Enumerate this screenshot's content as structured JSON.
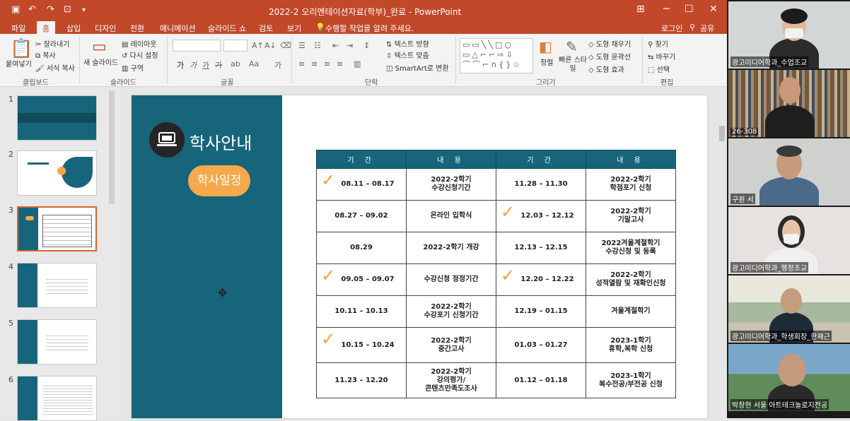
{
  "window": {
    "title": "2022-2 오리엔테이션자료(학부)_완료 - PowerPoint",
    "login": "로그인",
    "share": "공유",
    "tell_me": "수행할 작업을 알려 주세요."
  },
  "tabs": [
    "파일",
    "홈",
    "삽입",
    "디자인",
    "전환",
    "애니메이션",
    "슬라이드 쇼",
    "검토",
    "보기"
  ],
  "ribbon": {
    "clipboard": {
      "paste": "붙여넣기",
      "cut": "잘라내기",
      "copy": "복사",
      "format_painter": "서식 복사",
      "group": "클립보드"
    },
    "slides": {
      "new_slide": "새 슬라이드",
      "layout": "레이아웃",
      "reset": "다시 설정",
      "section": "구역",
      "group": "슬라이드"
    },
    "font": {
      "group": "글꼴"
    },
    "paragraph": {
      "text_direction": "텍스트 방향",
      "align_text": "텍스트 맞춤",
      "smartart": "SmartArt로 변환",
      "group": "단락"
    },
    "drawing": {
      "arrange": "정렬",
      "quick_styles": "빠른 스타일",
      "shape_fill": "도형 채우기",
      "shape_outline": "도형 윤곽선",
      "shape_effects": "도형 효과",
      "group": "그리기"
    },
    "editing": {
      "find": "찾기",
      "replace": "바꾸기",
      "select": "선택",
      "group": "편집"
    }
  },
  "thumbnails": [
    "1",
    "2",
    "3",
    "4",
    "5",
    "6"
  ],
  "slide": {
    "title": "학사안내",
    "badge": "학사일정",
    "table": {
      "headers": [
        "기 간",
        "내 용",
        "기 간",
        "내 용"
      ],
      "rows": [
        {
          "p1": "08.11 – 08.17",
          "c1a": "2022-2학기",
          "c1b": "수강신청기간",
          "p2": "11.28 – 11.30",
          "c2a": "2022-2학기",
          "c2b": "학점포기 신청"
        },
        {
          "p1": "08.27 – 09.02",
          "c1a": "온라인 입학식",
          "c1b": "",
          "p2": "12.03 – 12.12",
          "c2a": "2022-2학기",
          "c2b": "기말고사"
        },
        {
          "p1": "08.29",
          "c1a": "2022-2학기 개강",
          "c1b": "",
          "p2": "12.13 – 12.15",
          "c2a": "2022겨울계절학기",
          "c2b": "수강신청 및 등록"
        },
        {
          "p1": "09.05 – 09.07",
          "c1a": "수강신청 정정기간",
          "c1b": "",
          "p2": "12.20 – 12.22",
          "c2a": "2022-2학기",
          "c2b": "성적열람 및 재확인신청"
        },
        {
          "p1": "10.11 – 10.13",
          "c1a": "2022-2학기",
          "c1b": "수강포기 신청기간",
          "p2": "12.19 – 01.15",
          "c2a": "겨울계절학기",
          "c2b": ""
        },
        {
          "p1": "10.15 – 10.24",
          "c1a": "2022-2학기",
          "c1b": "중간고사",
          "p2": "01.03 – 01.27",
          "c2a": "2023-1학기",
          "c2b": "휴학,복학 신청"
        },
        {
          "p1": "11.23 – 12.20",
          "c1a": "2022-2학기",
          "c1b": "강의평가/",
          "c1c": "콘텐츠만족도조사",
          "p2": "01.12 – 01.18",
          "c2a": "2023-1학기",
          "c2b": "복수전공/부전공 신청"
        }
      ]
    }
  },
  "participants": [
    {
      "name": "광고미디어학과_수업조교"
    },
    {
      "name": "26-308"
    },
    {
      "name": "구원 서"
    },
    {
      "name": "광고미디어학과_행정조교"
    },
    {
      "name": "광고미디어학과_학생회장_한재근"
    },
    {
      "name": "박창현 서울 아트테크놀로지전공"
    }
  ],
  "colors": {
    "accent": "#c2482a",
    "teal": "#17657a",
    "orange": "#f6a94a",
    "check": "#f1a431"
  }
}
